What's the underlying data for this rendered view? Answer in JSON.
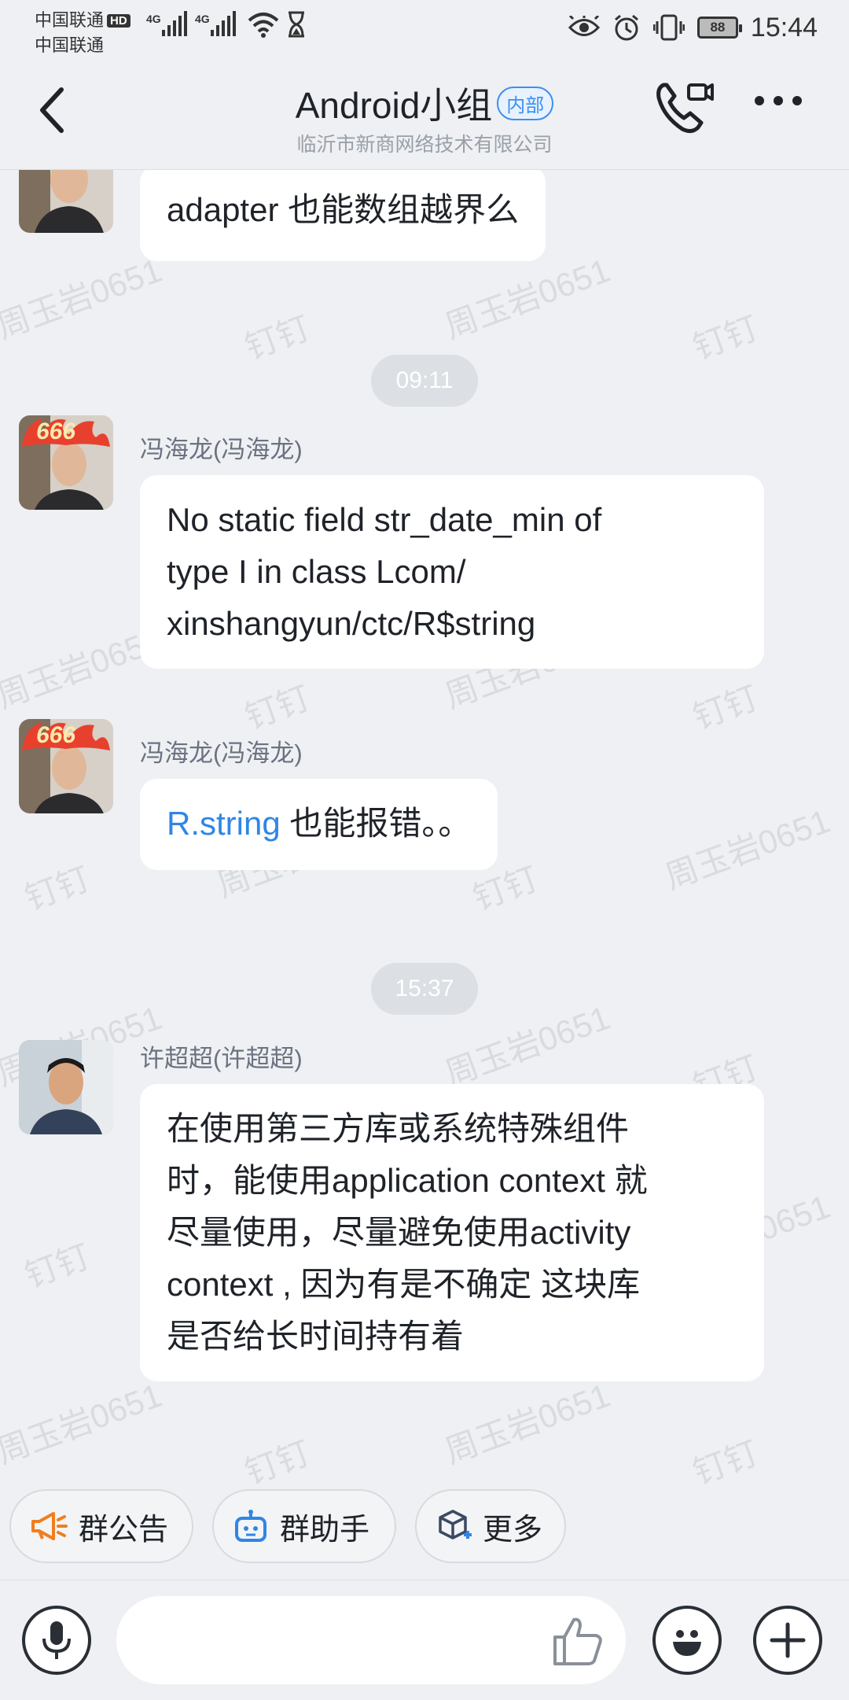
{
  "status_bar": {
    "carrier1": "中国联通",
    "carrier2": "中国联通",
    "hd_badge": "HD",
    "net1": "4G",
    "net2": "4G",
    "battery": "88",
    "time": "15:44"
  },
  "header": {
    "title": "Android小组",
    "tag": "内部",
    "subtitle": "临沂市新商网络技术有限公司"
  },
  "watermark": {
    "name": "周玉岩0651",
    "app": "钉钉"
  },
  "messages": [
    {
      "text": "adapter 也能数组越界么"
    },
    {
      "time": "09:11"
    },
    {
      "sender": "冯海龙(冯海龙)",
      "lines": [
        "No static field str_date_min of",
        "type I in class Lcom/",
        "xinshangyun/ctc/R$string"
      ]
    },
    {
      "sender": "冯海龙(冯海龙)",
      "link": "R.string",
      "text": " 也能报错。。"
    },
    {
      "time": "15:37"
    },
    {
      "sender": "许超超(许超超)",
      "lines": [
        "在使用第三方库或系统特殊组件",
        "时，能使用application context 就",
        "尽量使用，尽量避免使用activity",
        "context , 因为有是不确定 这块库",
        "是否给长时间持有着"
      ]
    }
  ],
  "avatar_badge": "666",
  "quick_actions": [
    {
      "label": "群公告",
      "icon": "megaphone-icon"
    },
    {
      "label": "群助手",
      "icon": "robot-icon"
    },
    {
      "label": "更多",
      "icon": "cube-icon"
    }
  ],
  "colors": {
    "accent": "#3C8FF0",
    "link": "#2F86E6",
    "megaphone": "#F07E1E",
    "background": "#EEF0F3"
  }
}
